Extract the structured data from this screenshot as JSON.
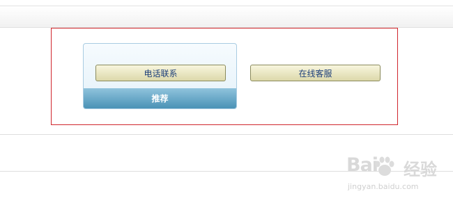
{
  "contact": {
    "recommend_label": "推荐",
    "phone_button": "电话联系",
    "online_service_button": "在线客服"
  },
  "watermark": {
    "logo_text": "Bai",
    "logo_cn": "经验",
    "url": "jingyan.baidu.com"
  },
  "colors": {
    "highlight_border": "#d0262c",
    "button_text": "#1d3f7a",
    "card_footer": "#4a92b6"
  }
}
